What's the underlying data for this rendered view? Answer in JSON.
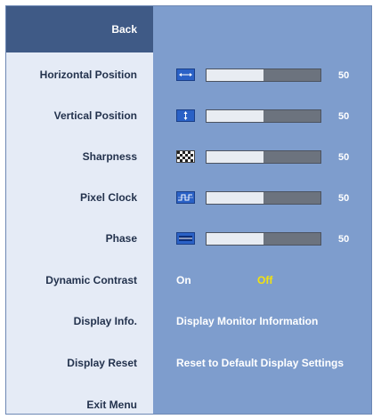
{
  "menu": {
    "back_label": "Back",
    "items": [
      {
        "label": "Horizontal Position",
        "icon": "horizontal-position-icon",
        "value": "50",
        "level": 0.5
      },
      {
        "label": "Vertical Position",
        "icon": "vertical-position-icon",
        "value": "50",
        "level": 0.5
      },
      {
        "label": "Sharpness",
        "icon": "sharpness-icon",
        "value": "50",
        "level": 0.5
      },
      {
        "label": "Pixel Clock",
        "icon": "pixel-clock-icon",
        "value": "50",
        "level": 0.5
      },
      {
        "label": "Phase",
        "icon": "phase-icon",
        "value": "50",
        "level": 0.5
      }
    ],
    "dynamic_contrast": {
      "label": "Dynamic Contrast",
      "on": "On",
      "off": "Off",
      "selected": "Off"
    },
    "display_info": {
      "label": "Display Info.",
      "value": "Display Monitor Information"
    },
    "display_reset": {
      "label": "Display Reset",
      "value": "Reset to Default Display Settings"
    },
    "exit_label": "Exit Menu"
  },
  "colors": {
    "right_panel": "#7e9dcd",
    "left_panel": "#e5ebf6",
    "selected_bg": "#3f5a86",
    "highlight_text": "#f2e20f"
  }
}
